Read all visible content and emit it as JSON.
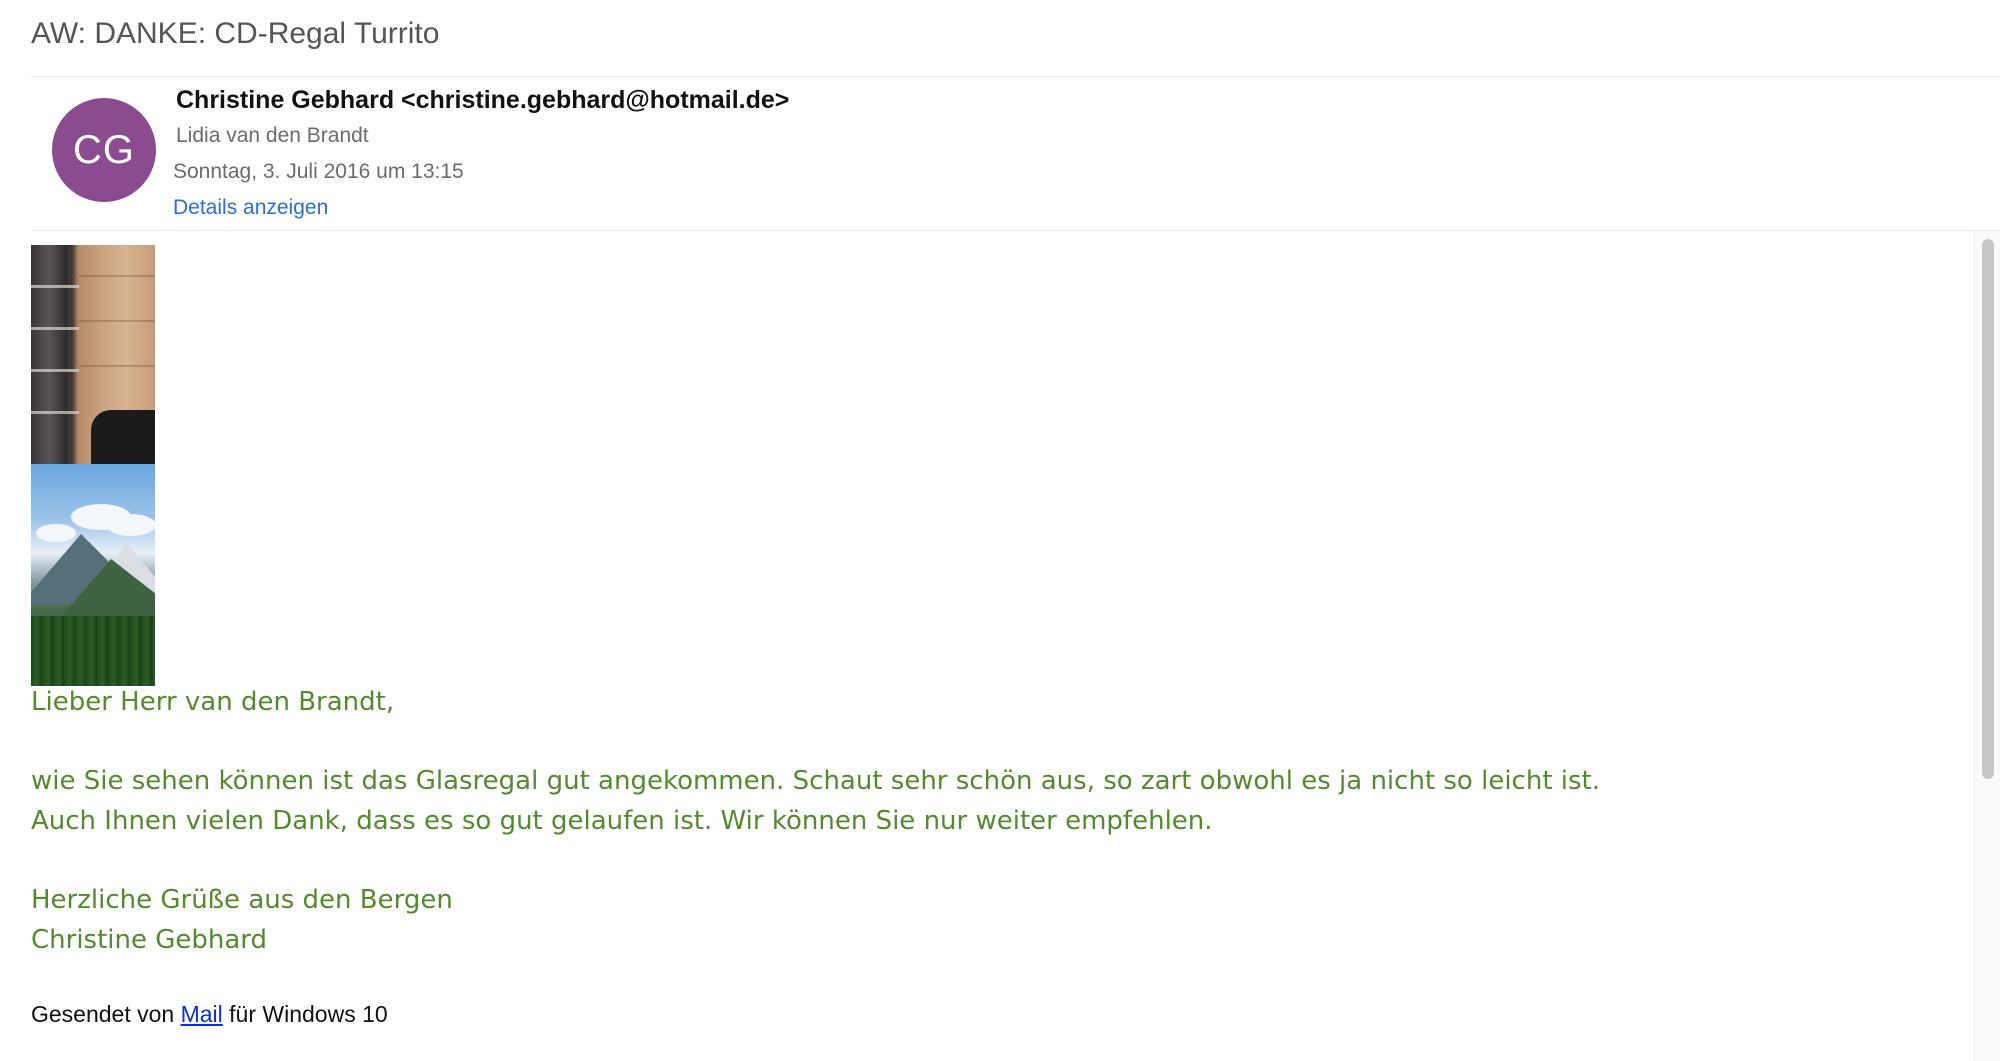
{
  "subject": "AW: DANKE: CD-Regal Turrito",
  "header": {
    "avatar_initials": "CG",
    "avatar_color": "#8b4b8f",
    "sender": "Christine Gebhard <christine.gebhard@hotmail.de>",
    "recipient": "Lidia van den Brandt",
    "date": "Sonntag, 3. Juli 2016 um 13:15",
    "details_link": "Details anzeigen"
  },
  "body": {
    "text_color": "#548a2e",
    "greeting": "Lieber Herr van den Brandt,",
    "lines": [
      "wie Sie sehen können ist das Glasregal gut angekommen. Schaut sehr schön aus, so zart obwohl es ja nicht so leicht ist.",
      "Auch Ihnen vielen Dank, dass es so gut gelaufen ist. Wir können Sie nur weiter empfehlen."
    ],
    "closing": "Herzliche Grüße aus den Bergen",
    "signature": "Christine Gebhard"
  },
  "footer": {
    "prefix": "Gesendet von ",
    "link_text": "Mail",
    "suffix": " für Windows 10"
  }
}
